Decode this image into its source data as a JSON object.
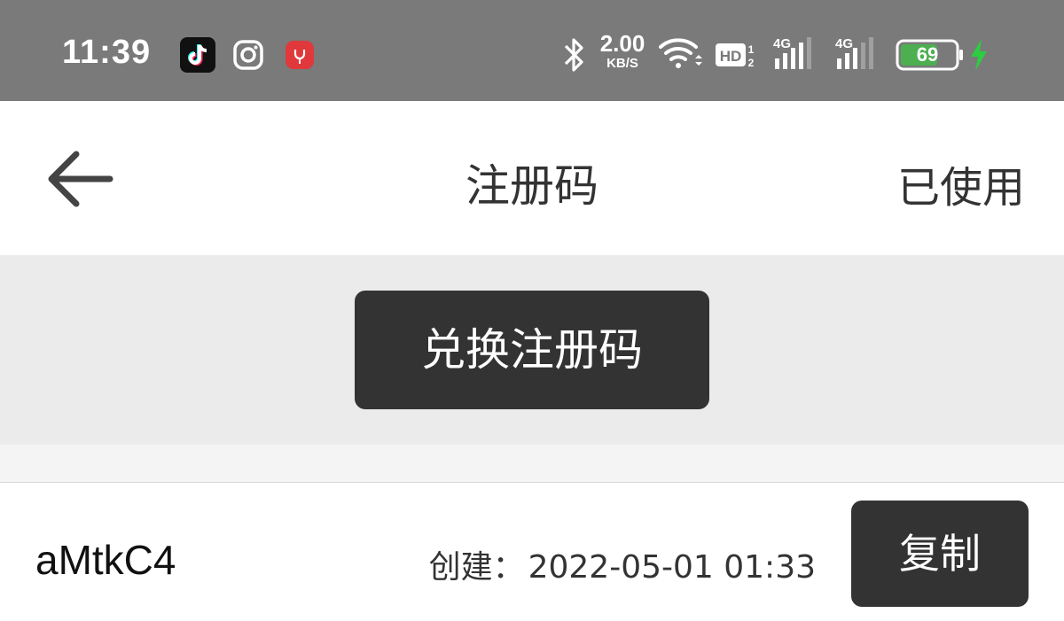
{
  "status_bar": {
    "time": "11:39",
    "network_speed_value": "2.00",
    "network_speed_unit": "KB/S",
    "battery_level": "69",
    "icons": [
      "tiktok-icon",
      "instagram-icon",
      "app-icon",
      "bluetooth-icon",
      "wifi-icon",
      "hd-icon",
      "signal-4g-icon",
      "signal-4g-icon",
      "battery-icon",
      "charging-icon"
    ],
    "colors": {
      "background": "#7a7a7a",
      "battery_fill": "#4caf50",
      "charging": "#2ecc40"
    }
  },
  "navbar": {
    "back_icon": "arrow-left-icon",
    "title": "注册码",
    "right_action": "已使用"
  },
  "redeem": {
    "button_label": "兑换注册码"
  },
  "codes": [
    {
      "code": "aMtkC4",
      "created_label": "创建：",
      "created_at": "2022-05-01 01:33",
      "copy_label": "复制"
    }
  ],
  "colors": {
    "primary_button": "#333333",
    "section_background": "#ebebeb"
  }
}
